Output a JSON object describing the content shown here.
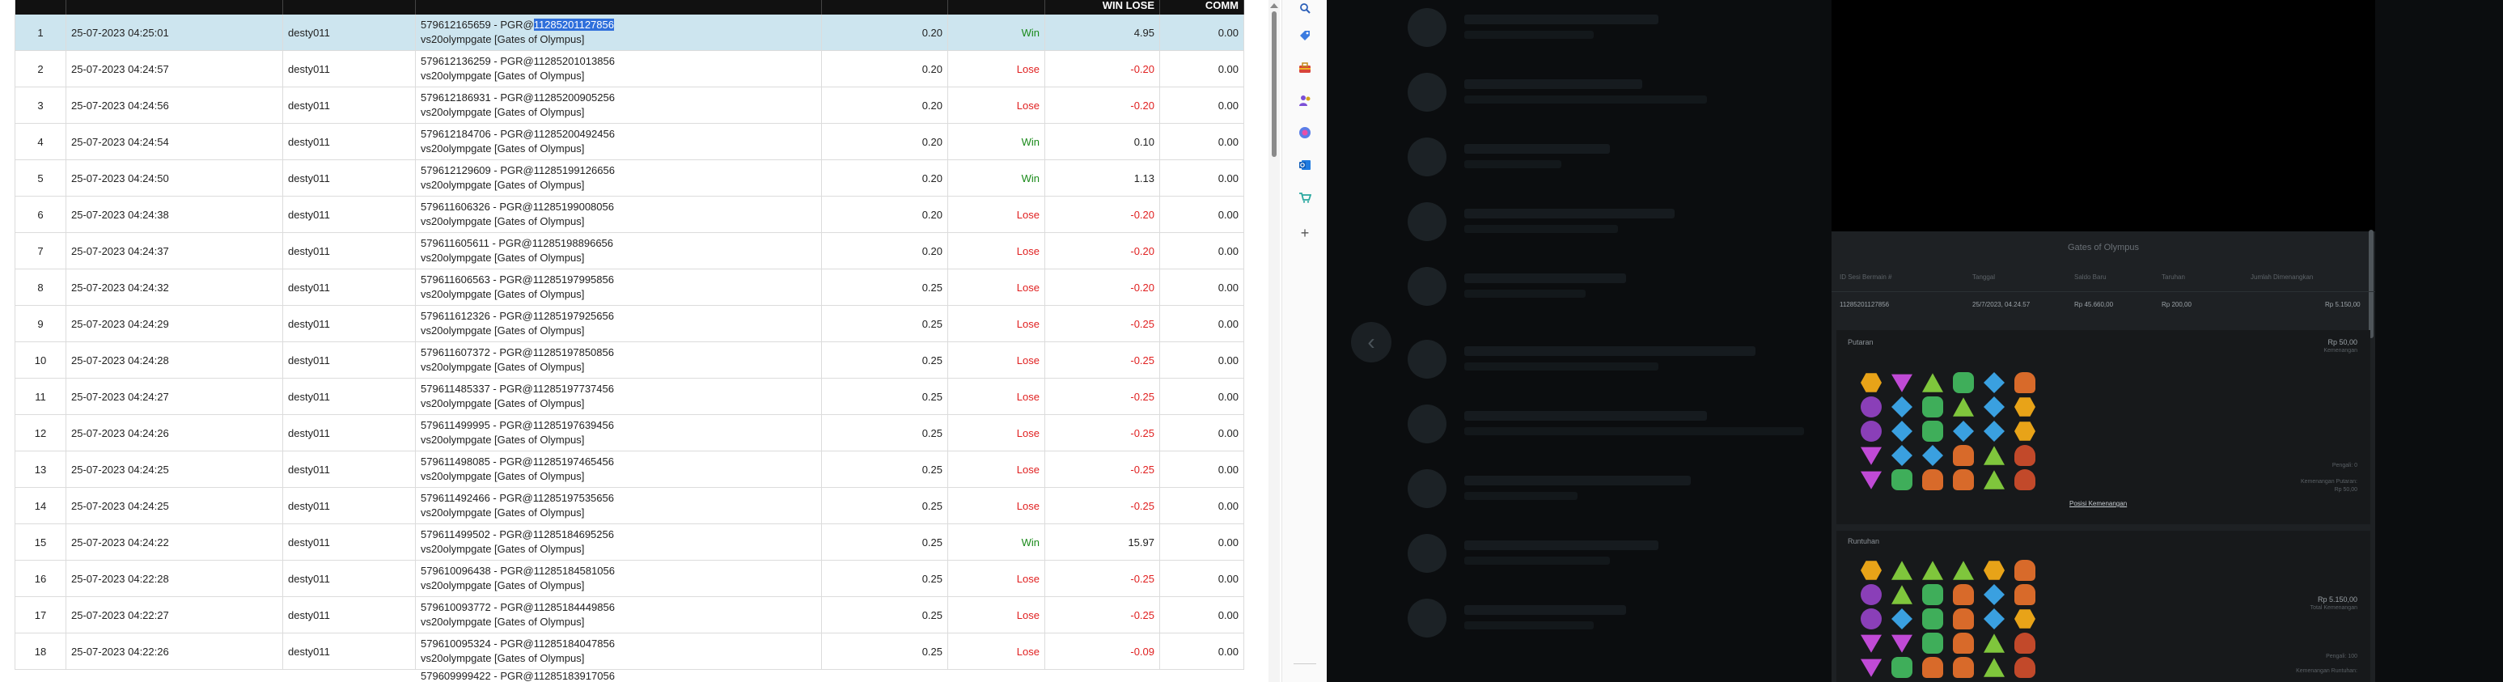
{
  "table": {
    "columns": [
      "",
      "",
      "",
      "",
      "",
      "",
      "WIN LOSE",
      "COMM"
    ],
    "rows": [
      {
        "no": "1",
        "date": "25-07-2023 04:25:01",
        "user": "desty011",
        "desc_pre": "579612165659 - PGR@",
        "desc_hl": "11285201127856",
        "desc_line2": "vs20olympgate [Gates of Olympus]",
        "bet": "0.20",
        "result": "Win",
        "winlose": "4.95",
        "comm": "0.00"
      },
      {
        "no": "2",
        "date": "25-07-2023 04:24:57",
        "user": "desty011",
        "desc_pre": "579612136259 - PGR@11285201013856",
        "desc_hl": "",
        "desc_line2": "vs20olympgate [Gates of Olympus]",
        "bet": "0.20",
        "result": "Lose",
        "winlose": "-0.20",
        "comm": "0.00"
      },
      {
        "no": "3",
        "date": "25-07-2023 04:24:56",
        "user": "desty011",
        "desc_pre": "579612186931 - PGR@11285200905256",
        "desc_hl": "",
        "desc_line2": "vs20olympgate [Gates of Olympus]",
        "bet": "0.20",
        "result": "Lose",
        "winlose": "-0.20",
        "comm": "0.00"
      },
      {
        "no": "4",
        "date": "25-07-2023 04:24:54",
        "user": "desty011",
        "desc_pre": "579612184706 - PGR@11285200492456",
        "desc_hl": "",
        "desc_line2": "vs20olympgate [Gates of Olympus]",
        "bet": "0.20",
        "result": "Win",
        "winlose": "0.10",
        "comm": "0.00"
      },
      {
        "no": "5",
        "date": "25-07-2023 04:24:50",
        "user": "desty011",
        "desc_pre": "579612129609 - PGR@11285199126656",
        "desc_hl": "",
        "desc_line2": "vs20olympgate [Gates of Olympus]",
        "bet": "0.20",
        "result": "Win",
        "winlose": "1.13",
        "comm": "0.00"
      },
      {
        "no": "6",
        "date": "25-07-2023 04:24:38",
        "user": "desty011",
        "desc_pre": "579611606326 - PGR@11285199008056",
        "desc_hl": "",
        "desc_line2": "vs20olympgate [Gates of Olympus]",
        "bet": "0.20",
        "result": "Lose",
        "winlose": "-0.20",
        "comm": "0.00"
      },
      {
        "no": "7",
        "date": "25-07-2023 04:24:37",
        "user": "desty011",
        "desc_pre": "579611605611 - PGR@11285198896656",
        "desc_hl": "",
        "desc_line2": "vs20olympgate [Gates of Olympus]",
        "bet": "0.20",
        "result": "Lose",
        "winlose": "-0.20",
        "comm": "0.00"
      },
      {
        "no": "8",
        "date": "25-07-2023 04:24:32",
        "user": "desty011",
        "desc_pre": "579611606563 - PGR@11285197995856",
        "desc_hl": "",
        "desc_line2": "vs20olympgate [Gates of Olympus]",
        "bet": "0.25",
        "result": "Lose",
        "winlose": "-0.20",
        "comm": "0.00"
      },
      {
        "no": "9",
        "date": "25-07-2023 04:24:29",
        "user": "desty011",
        "desc_pre": "579611612326 - PGR@11285197925656",
        "desc_hl": "",
        "desc_line2": "vs20olympgate [Gates of Olympus]",
        "bet": "0.25",
        "result": "Lose",
        "winlose": "-0.25",
        "comm": "0.00"
      },
      {
        "no": "10",
        "date": "25-07-2023 04:24:28",
        "user": "desty011",
        "desc_pre": "579611607372 - PGR@11285197850856",
        "desc_hl": "",
        "desc_line2": "vs20olympgate [Gates of Olympus]",
        "bet": "0.25",
        "result": "Lose",
        "winlose": "-0.25",
        "comm": "0.00"
      },
      {
        "no": "11",
        "date": "25-07-2023 04:24:27",
        "user": "desty011",
        "desc_pre": "579611485337 - PGR@11285197737456",
        "desc_hl": "",
        "desc_line2": "vs20olympgate [Gates of Olympus]",
        "bet": "0.25",
        "result": "Lose",
        "winlose": "-0.25",
        "comm": "0.00"
      },
      {
        "no": "12",
        "date": "25-07-2023 04:24:26",
        "user": "desty011",
        "desc_pre": "579611499995 - PGR@11285197639456",
        "desc_hl": "",
        "desc_line2": "vs20olympgate [Gates of Olympus]",
        "bet": "0.25",
        "result": "Lose",
        "winlose": "-0.25",
        "comm": "0.00"
      },
      {
        "no": "13",
        "date": "25-07-2023 04:24:25",
        "user": "desty011",
        "desc_pre": "579611498085 - PGR@11285197465456",
        "desc_hl": "",
        "desc_line2": "vs20olympgate [Gates of Olympus]",
        "bet": "0.25",
        "result": "Lose",
        "winlose": "-0.25",
        "comm": "0.00"
      },
      {
        "no": "14",
        "date": "25-07-2023 04:24:25",
        "user": "desty011",
        "desc_pre": "579611492466 - PGR@11285197535656",
        "desc_hl": "",
        "desc_line2": "vs20olympgate [Gates of Olympus]",
        "bet": "0.25",
        "result": "Lose",
        "winlose": "-0.25",
        "comm": "0.00"
      },
      {
        "no": "15",
        "date": "25-07-2023 04:24:22",
        "user": "desty011",
        "desc_pre": "579611499502 - PGR@11285184695256",
        "desc_hl": "",
        "desc_line2": "vs20olympgate [Gates of Olympus]",
        "bet": "0.25",
        "result": "Win",
        "winlose": "15.97",
        "comm": "0.00"
      },
      {
        "no": "16",
        "date": "25-07-2023 04:22:28",
        "user": "desty011",
        "desc_pre": "579610096438 - PGR@11285184581056",
        "desc_hl": "",
        "desc_line2": "vs20olympgate [Gates of Olympus]",
        "bet": "0.25",
        "result": "Lose",
        "winlose": "-0.25",
        "comm": "0.00"
      },
      {
        "no": "17",
        "date": "25-07-2023 04:22:27",
        "user": "desty011",
        "desc_pre": "579610093772 - PGR@11285184449856",
        "desc_hl": "",
        "desc_line2": "vs20olympgate [Gates of Olympus]",
        "bet": "0.25",
        "result": "Lose",
        "winlose": "-0.25",
        "comm": "0.00"
      },
      {
        "no": "18",
        "date": "25-07-2023 04:22:26",
        "user": "desty011",
        "desc_pre": "579610095324 - PGR@11285184047856",
        "desc_hl": "",
        "desc_line2": "vs20olympgate [Gates of Olympus]",
        "bet": "0.25",
        "result": "Lose",
        "winlose": "-0.09",
        "comm": "0.00"
      }
    ],
    "partial_row_text": "579609999422 - PGR@11285183917056"
  },
  "side_icons": [
    "search-icon",
    "tag-icon",
    "toolbox-icon",
    "people-icon",
    "copilot-icon",
    "outlook-icon",
    "shopping-icon",
    "plus-icon"
  ],
  "colors": {
    "win": "#1a8a1a",
    "lose": "#e02020",
    "selected_row": "#cde5ef",
    "highlight": "#2f6fdb",
    "header_bg": "#111111"
  },
  "modal": {
    "title": "Gates of Olympus",
    "info_headers": [
      "ID Sesi Bermain #",
      "Tanggal",
      "Saldo Baru",
      "Taruhan",
      "Jumlah Dimenangkan"
    ],
    "info_values": [
      "11285201127856",
      "25/7/2023, 04.24.57",
      "Rp 45.660,00",
      "Rp 200,00",
      "Rp 5.150,00"
    ],
    "putaran": {
      "label": "Putaran",
      "amount": "Rp 50,00",
      "amount_sub": "Kemenangan",
      "right_notes": [
        "Pengali: 0",
        "Kemenangan Putaran:",
        "Rp 50,00"
      ],
      "link": "Posisi Kemenangan"
    },
    "runtuhan": {
      "label": "Runtuhan",
      "amount": "Rp 5.150,00",
      "amount_sub": "Total Kemenangan",
      "right_notes": [
        "Pengali: 100",
        "Kemenangan Runtuhan:"
      ]
    }
  }
}
